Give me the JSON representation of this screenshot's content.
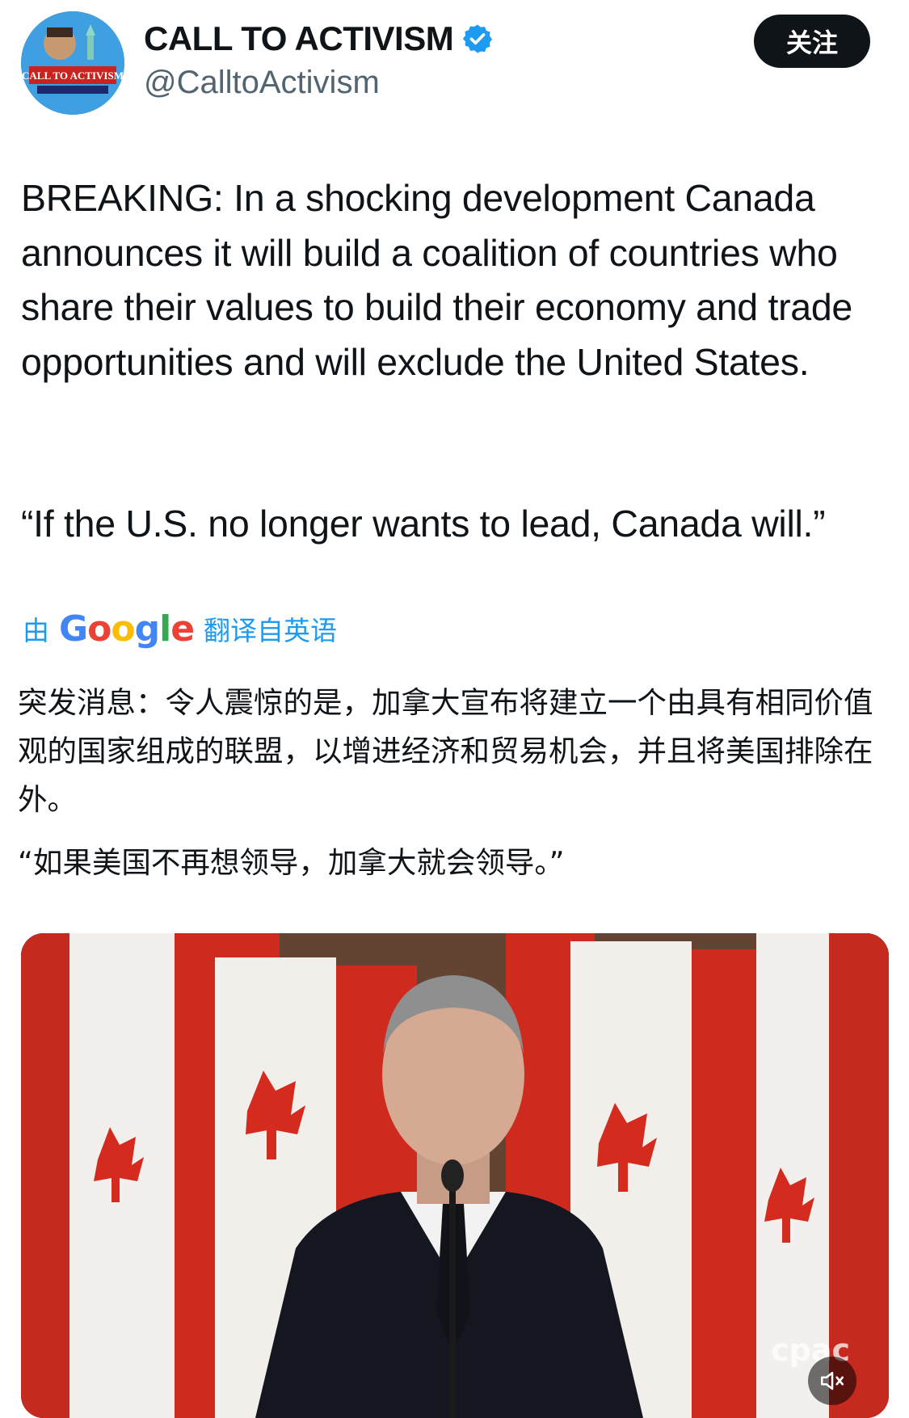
{
  "author": {
    "display_name": "CALL TO ACTIVISM",
    "handle": "@CalltoActivism",
    "avatar_text": "CALL TO ACTIVISM",
    "verified_color": "#1d9bf0"
  },
  "follow_button": {
    "label": "关注"
  },
  "tweet": {
    "body": "BREAKING: In a shocking development Canada announces it will build a coalition of countries who share their values to build their economy and trade opportunities and will exclude the United States.",
    "quote": "“If the U.S. no longer wants to lead, Canada will.”"
  },
  "translation": {
    "prefix": "由",
    "provider": "Google",
    "suffix": "翻译自英语",
    "body": "突发消息：令人震惊的是，加拿大宣布将建立一个由具有相同价值观的国家组成的联盟，以增进经济和贸易机会，并且将美国排除在外。",
    "quote": "“如果美国不再想领导，加拿大就会领导。”"
  },
  "media": {
    "type": "video",
    "watermark": "cpac",
    "mute_icon": "speaker-muted-icon"
  },
  "colors": {
    "text": "#0f1419",
    "secondary_text": "#536471",
    "link": "#1d9bf0",
    "button_bg": "#0f1419",
    "flag_red": "#d52b1e",
    "backdrop": "#6a4a38"
  }
}
